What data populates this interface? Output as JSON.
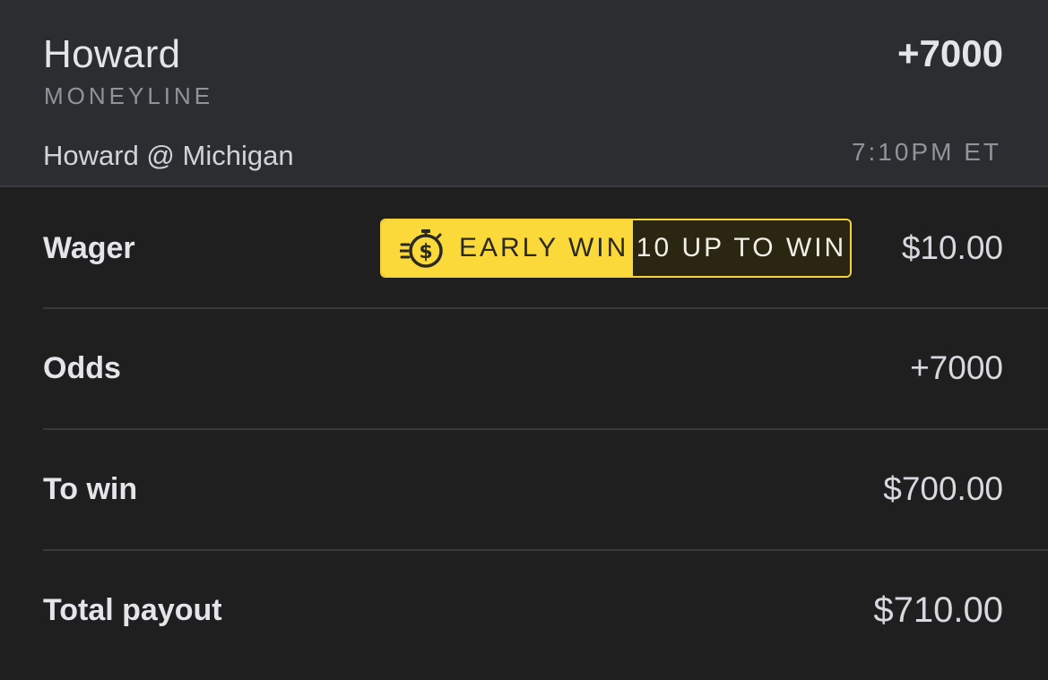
{
  "header": {
    "selection": "Howard",
    "market": "MONEYLINE",
    "odds": "+7000",
    "event": "Howard @ Michigan",
    "time": "7:10PM ET"
  },
  "badge": {
    "icon": "stopwatch-dollar-icon",
    "label": "EARLY WIN",
    "condition": "10 UP TO WIN",
    "color_primary": "#fbd93a",
    "color_dark": "#2a2612"
  },
  "rows": [
    {
      "label": "Wager",
      "value": "$10.00"
    },
    {
      "label": "Odds",
      "value": "+7000"
    },
    {
      "label": "To win",
      "value": "$700.00"
    },
    {
      "label": "Total payout",
      "value": "$710.00"
    }
  ]
}
